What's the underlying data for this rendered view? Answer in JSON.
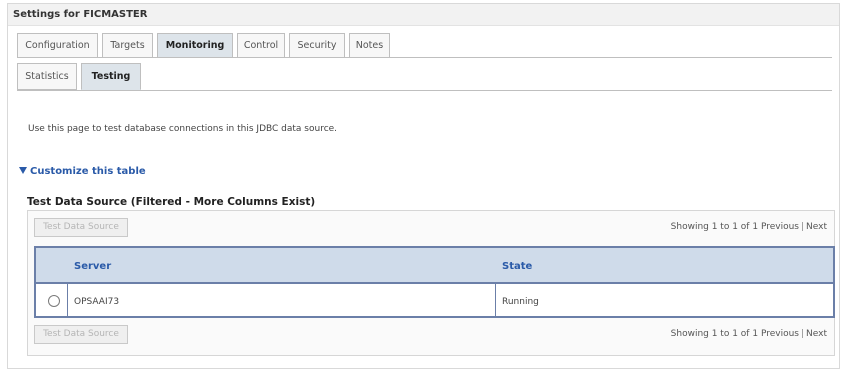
{
  "header": {
    "title": "Settings for FICMASTER"
  },
  "tabs": [
    {
      "label": "Configuration"
    },
    {
      "label": "Targets"
    },
    {
      "label": "Monitoring"
    },
    {
      "label": "Control"
    },
    {
      "label": "Security"
    },
    {
      "label": "Notes"
    }
  ],
  "active_tab": "Monitoring",
  "subtabs": [
    {
      "label": "Statistics"
    },
    {
      "label": "Testing"
    }
  ],
  "active_subtab": "Testing",
  "description": "Use this page to test database connections in this JDBC data source.",
  "customize_label": "Customize this table",
  "section_title": "Test Data Source (Filtered - More Columns Exist)",
  "actions": {
    "test_button_label": "Test Data Source"
  },
  "paging": {
    "showing": "Showing 1 to 1 of 1",
    "previous": "Previous",
    "separator": "|",
    "next": "Next"
  },
  "table": {
    "columns": [
      "Server",
      "State"
    ],
    "rows": [
      {
        "server": "OPSAAI73",
        "state": "Running",
        "selected": false
      }
    ]
  },
  "colors": {
    "link": "#2a5aa8",
    "header_bg": "#cfdbea",
    "table_border": "#6b7fa8",
    "active_tab_bg": "#dde4ea"
  }
}
